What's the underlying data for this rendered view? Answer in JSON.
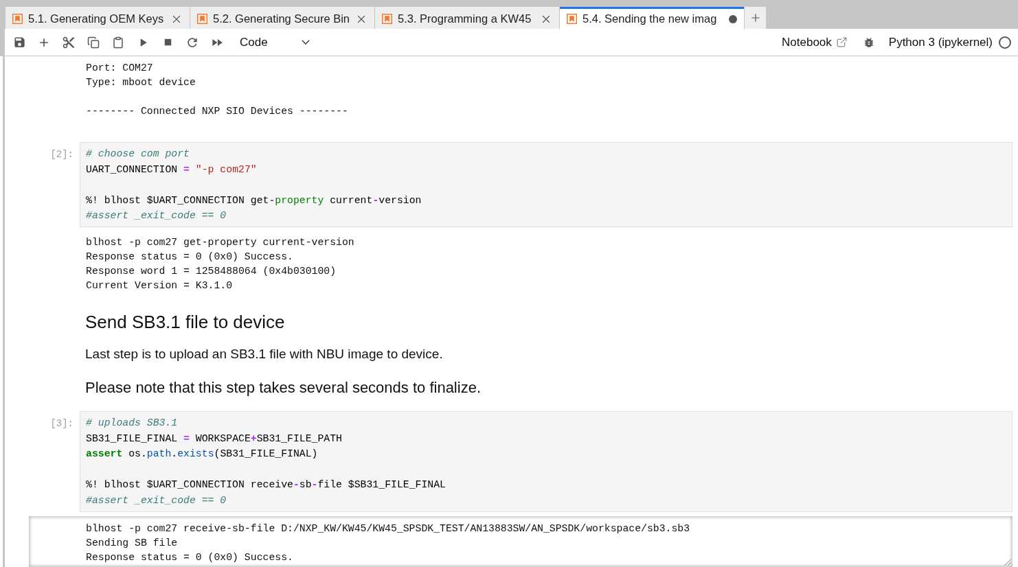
{
  "tabs": [
    {
      "label": "5.1. Generating OEM Keys",
      "selected": false,
      "dirty": false
    },
    {
      "label": "5.2. Generating Secure Bin",
      "selected": false,
      "dirty": false
    },
    {
      "label": "5.3. Programming a KW45",
      "selected": false,
      "dirty": false
    },
    {
      "label": "5.4. Sending the new imag",
      "selected": true,
      "dirty": true
    }
  ],
  "toolbar": {
    "cell_type": "Code",
    "notebook_link": "Notebook",
    "kernel": {
      "name": "Python 3 (ipykernel)",
      "busy": false
    }
  },
  "cells": [
    {
      "kind": "output",
      "output": {
        "scrolled": false,
        "groups": [
          [
            "Port: COM27",
            "Type: mboot device"
          ],
          [
            "-------- Connected NXP SIO Devices --------"
          ]
        ]
      }
    },
    {
      "kind": "code",
      "prompt": "[2]:",
      "input_groups": [
        [
          [
            {
              "kind": "comment",
              "text": "# choose com port"
            }
          ],
          [
            {
              "kind": "plain",
              "text": "UART_CONNECTION "
            },
            {
              "kind": "operator",
              "text": "="
            },
            {
              "kind": "string",
              "text": " \"-p com27\""
            }
          ]
        ],
        [
          [
            {
              "kind": "plain",
              "text": "%! blhost $UART_CONNECTION get"
            },
            {
              "kind": "operator",
              "text": "-"
            },
            {
              "kind": "builtin",
              "text": "property"
            },
            {
              "kind": "plain",
              "text": " current"
            },
            {
              "kind": "operator",
              "text": "-"
            },
            {
              "kind": "plain",
              "text": "version"
            }
          ],
          [
            {
              "kind": "comment",
              "text": "#assert _exit_code == 0"
            }
          ]
        ]
      ],
      "output": {
        "scrolled": false,
        "groups": [
          [
            "blhost -p com27 get-property current-version",
            "Response status = 0 (0x0) Success.",
            "Response word 1 = 1258488064 (0x4b030100)",
            "Current Version = K3.1.0"
          ]
        ]
      }
    },
    {
      "kind": "markdown",
      "blocks": [
        {
          "kind": "heading",
          "text": "Send SB3.1 file to device"
        },
        {
          "kind": "paragraph",
          "text": "Last step is to upload an SB3.1 file with NBU image to device."
        },
        {
          "kind": "large",
          "text": "Please note that this step takes several seconds to finalize."
        }
      ]
    },
    {
      "kind": "code",
      "prompt": "[3]:",
      "input_groups": [
        [
          [
            {
              "kind": "comment",
              "text": "# uploads SB3.1"
            }
          ],
          [
            {
              "kind": "plain",
              "text": "SB31_FILE_FINAL "
            },
            {
              "kind": "operator",
              "text": "="
            },
            {
              "kind": "plain",
              "text": " WORKSPACE"
            },
            {
              "kind": "operator",
              "text": "+"
            },
            {
              "kind": "plain",
              "text": "SB31_FILE_PATH"
            }
          ],
          [
            {
              "kind": "keyword",
              "text": "assert"
            },
            {
              "kind": "plain",
              "text": " os."
            },
            {
              "kind": "attribute",
              "text": "path"
            },
            {
              "kind": "plain",
              "text": "."
            },
            {
              "kind": "attribute",
              "text": "exists"
            },
            {
              "kind": "plain",
              "text": "(SB31_FILE_FINAL)"
            }
          ]
        ],
        [
          [
            {
              "kind": "plain",
              "text": "%! blhost $UART_CONNECTION receive"
            },
            {
              "kind": "operator",
              "text": "-"
            },
            {
              "kind": "plain",
              "text": "sb"
            },
            {
              "kind": "operator",
              "text": "-"
            },
            {
              "kind": "plain",
              "text": "file $SB31_FILE_FINAL"
            }
          ],
          [
            {
              "kind": "comment",
              "text": "#assert _exit_code == 0"
            }
          ]
        ]
      ],
      "output": {
        "scrolled": true,
        "groups": [
          [
            "blhost -p com27 receive-sb-file D:/NXP_KW/KW45/KW45_SPSDK_TEST/AN13883SW/AN_SPSDK/workspace/sb3.sb3",
            "Sending SB file",
            "Response status = 0 (0x0) Success."
          ]
        ]
      }
    }
  ]
}
